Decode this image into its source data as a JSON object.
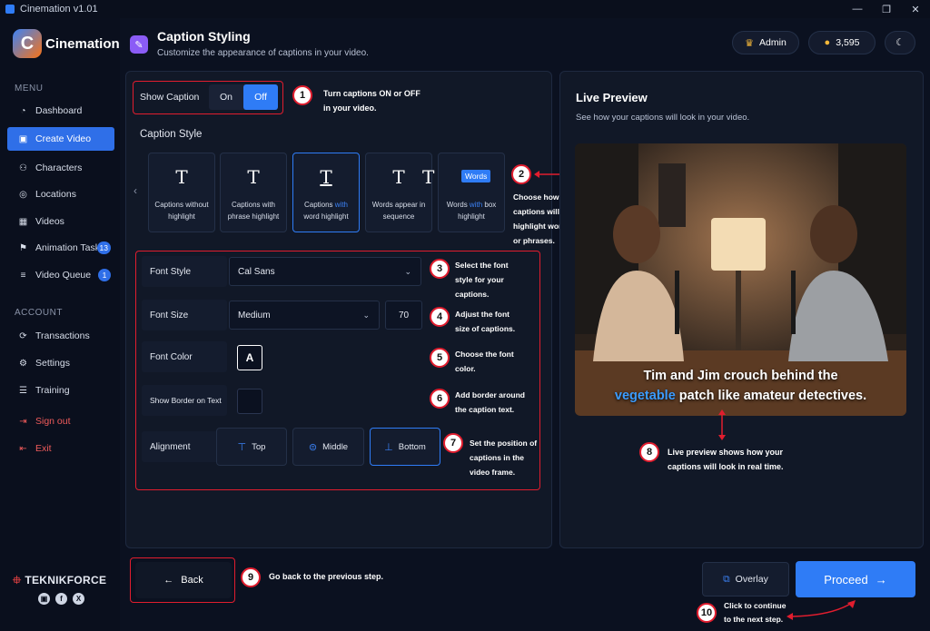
{
  "window": {
    "title": "Cinemation v1.01",
    "minimize": "—",
    "maximize": "❐",
    "close": "✕"
  },
  "brand": {
    "logo_letter": "C",
    "name": "Cinemation"
  },
  "sidebar": {
    "menu_heading": "MENU",
    "menu": [
      {
        "label": "Dashboard",
        "icon": "◔"
      },
      {
        "label": "Create Video",
        "icon": "▣"
      },
      {
        "label": "Characters",
        "icon": "⚇"
      },
      {
        "label": "Locations",
        "icon": "◎"
      },
      {
        "label": "Videos",
        "icon": "▦"
      },
      {
        "label": "Animation Tasks",
        "icon": "⚑",
        "badge": "13"
      },
      {
        "label": "Video Queue",
        "icon": "≡",
        "badge": "1"
      }
    ],
    "account_heading": "ACCOUNT",
    "account": [
      {
        "label": "Transactions",
        "icon": "⟳"
      },
      {
        "label": "Settings",
        "icon": "⚙"
      },
      {
        "label": "Training",
        "icon": "☰"
      },
      {
        "label": "Sign out",
        "icon": "⇥"
      },
      {
        "label": "Exit",
        "icon": "⇤"
      }
    ],
    "footer_brand": "TEKNIKFORCE",
    "footer_brand_icon": "⯐",
    "socials": [
      "▣",
      "f",
      "X"
    ]
  },
  "header": {
    "icon": "✎",
    "title": "Caption Styling",
    "subtitle": "Customize the appearance of captions in your video.",
    "admin_icon": "♛",
    "admin_label": "Admin",
    "coin_icon": "●",
    "credits": "3,595",
    "theme_icon": "☾"
  },
  "show_caption": {
    "label": "Show Caption",
    "on": "On",
    "off": "Off",
    "selected": "Off"
  },
  "caption_style": {
    "heading": "Caption Style",
    "prev": "‹",
    "cards": [
      {
        "icon": "T",
        "line1": "Captions without",
        "line2": "highlight",
        "hl": ""
      },
      {
        "icon": "T",
        "line1": "Captions with",
        "line2": "phrase highlight",
        "hl": ""
      },
      {
        "icon": "T",
        "line1a": "Captions ",
        "hl": "with",
        "line2": "word highlight"
      },
      {
        "icon": "T",
        "line1": "Words appear in",
        "line2": "sequence",
        "hl": ""
      },
      {
        "icon": "T",
        "box_word": "Words",
        "line1a": "Words ",
        "hl": "with",
        "line1b": " box",
        "line2": "highlight"
      }
    ]
  },
  "font": {
    "style_label": "Font Style",
    "style_value": "Cal Sans",
    "size_label": "Font Size",
    "size_value": "Medium",
    "size_number": "70",
    "color_label": "Font Color",
    "color_sample": "A",
    "border_label": "Show Border on Text",
    "alignment_label": "Alignment",
    "align_top": "Top",
    "align_middle": "Middle",
    "align_bottom": "Bottom",
    "chevron": "⌄"
  },
  "annotations": [
    {
      "n": "1",
      "lines": [
        "Turn captions ON or OFF",
        "in your video."
      ]
    },
    {
      "n": "2",
      "lines": [
        "Choose how your",
        "captions will",
        "highlight words",
        "or phrases."
      ]
    },
    {
      "n": "3",
      "lines": [
        "Select the font",
        "style for your",
        "captions."
      ]
    },
    {
      "n": "4",
      "lines": [
        "Adjust the font",
        "size of captions."
      ]
    },
    {
      "n": "5",
      "lines": [
        "Choose the font",
        "color."
      ]
    },
    {
      "n": "6",
      "lines": [
        "Add border around",
        "the caption text."
      ]
    },
    {
      "n": "7",
      "lines": [
        "Set the position of",
        "captions in the",
        "video frame."
      ]
    },
    {
      "n": "8",
      "lines": [
        "Live preview shows how your",
        "captions will look in real time."
      ]
    },
    {
      "n": "9",
      "lines": [
        "Go back to the previous step."
      ]
    },
    {
      "n": "10",
      "lines": [
        "Click to continue",
        "to the next step."
      ]
    }
  ],
  "preview": {
    "title": "Live Preview",
    "subtitle": "See how your captions will look in your video.",
    "caption_line1": "Tim and Jim crouch behind the",
    "caption_highlight": "vegetable",
    "caption_line2_rest": " patch like amateur detectives."
  },
  "footer": {
    "back": "Back",
    "back_icon": "←",
    "overlay": "Overlay",
    "overlay_icon": "⧉",
    "proceed": "Proceed",
    "proceed_icon": "→"
  },
  "colors": {
    "accent": "#2f7cf6",
    "annotation_red": "#e11d2e",
    "highlight_word": "#3b9cff",
    "bg": "#0b1120"
  }
}
